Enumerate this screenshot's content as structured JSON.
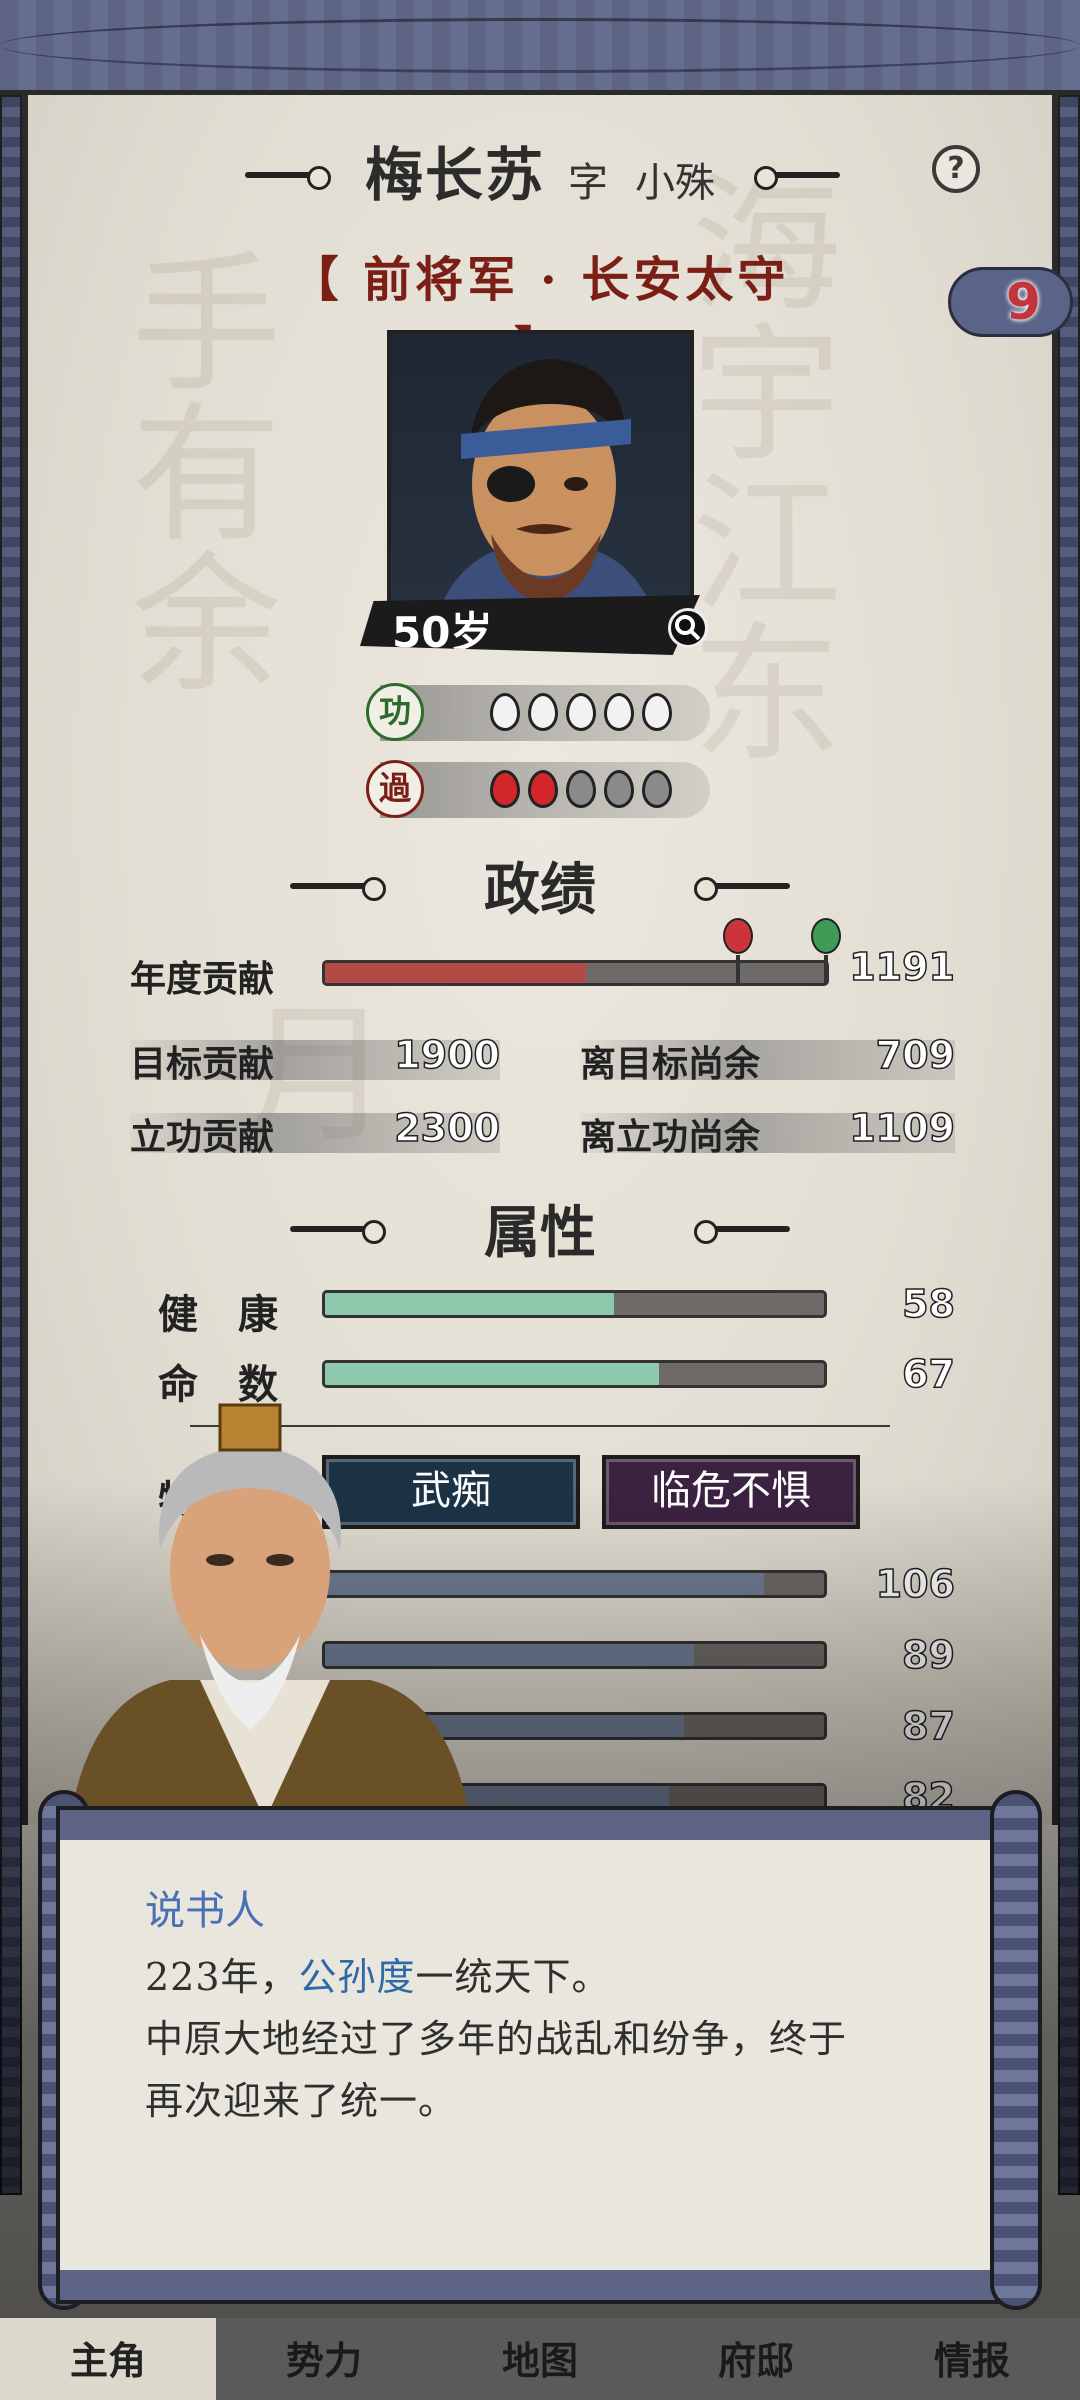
{
  "character": {
    "name": "梅长苏",
    "courtesy_label": "字",
    "courtesy_name": "小殊",
    "title_left_bracket": "【",
    "title": "前将军 · 长安太守",
    "title_right_bracket": "】",
    "age": "50岁",
    "badge_number": "9"
  },
  "merit": {
    "seal": "功",
    "filled": 5,
    "total": 5
  },
  "fault": {
    "seal": "過",
    "filled": 2,
    "total": 5
  },
  "achievements": {
    "section_title": "政绩",
    "annual_label": "年度贡献",
    "annual_value": "1191",
    "annual_fraction": 0.52,
    "target_label": "目标贡献",
    "target_value": "1900",
    "to_target_label": "离目标尚余",
    "to_target_value": "709",
    "merit_label": "立功贡献",
    "merit_value": "2300",
    "to_merit_label": "离立功尚余",
    "to_merit_value": "1109"
  },
  "attributes": {
    "section_title": "属性",
    "health_label": "健　康",
    "health_value": "58",
    "health_fraction": 0.58,
    "fate_label": "命　数",
    "fate_value": "67",
    "fate_fraction": 0.67,
    "traits_label": "特长",
    "traits": [
      "武痴",
      "临危不惧"
    ],
    "stats": [
      {
        "value": "106",
        "fraction": 0.88
      },
      {
        "value": "89",
        "fraction": 0.74
      },
      {
        "value": "87",
        "fraction": 0.72
      },
      {
        "value": "82",
        "fraction": 0.69
      }
    ]
  },
  "dialog": {
    "speaker": "说书人",
    "line1_pre": "223年，",
    "line1_hl": "公孙度",
    "line1_post": "一统天下。",
    "line2": "中原大地经过了多年的战乱和纷争，终于",
    "line3": "再次迎来了统一。"
  },
  "nav": {
    "items": [
      "主角",
      "势力",
      "地图",
      "府邸",
      "情报"
    ]
  },
  "colors": {
    "title_red": "#7a1e16",
    "trait_blue": "#1c3346",
    "trait_purple": "#3b2241",
    "highlight_blue": "#2e6aa8"
  }
}
